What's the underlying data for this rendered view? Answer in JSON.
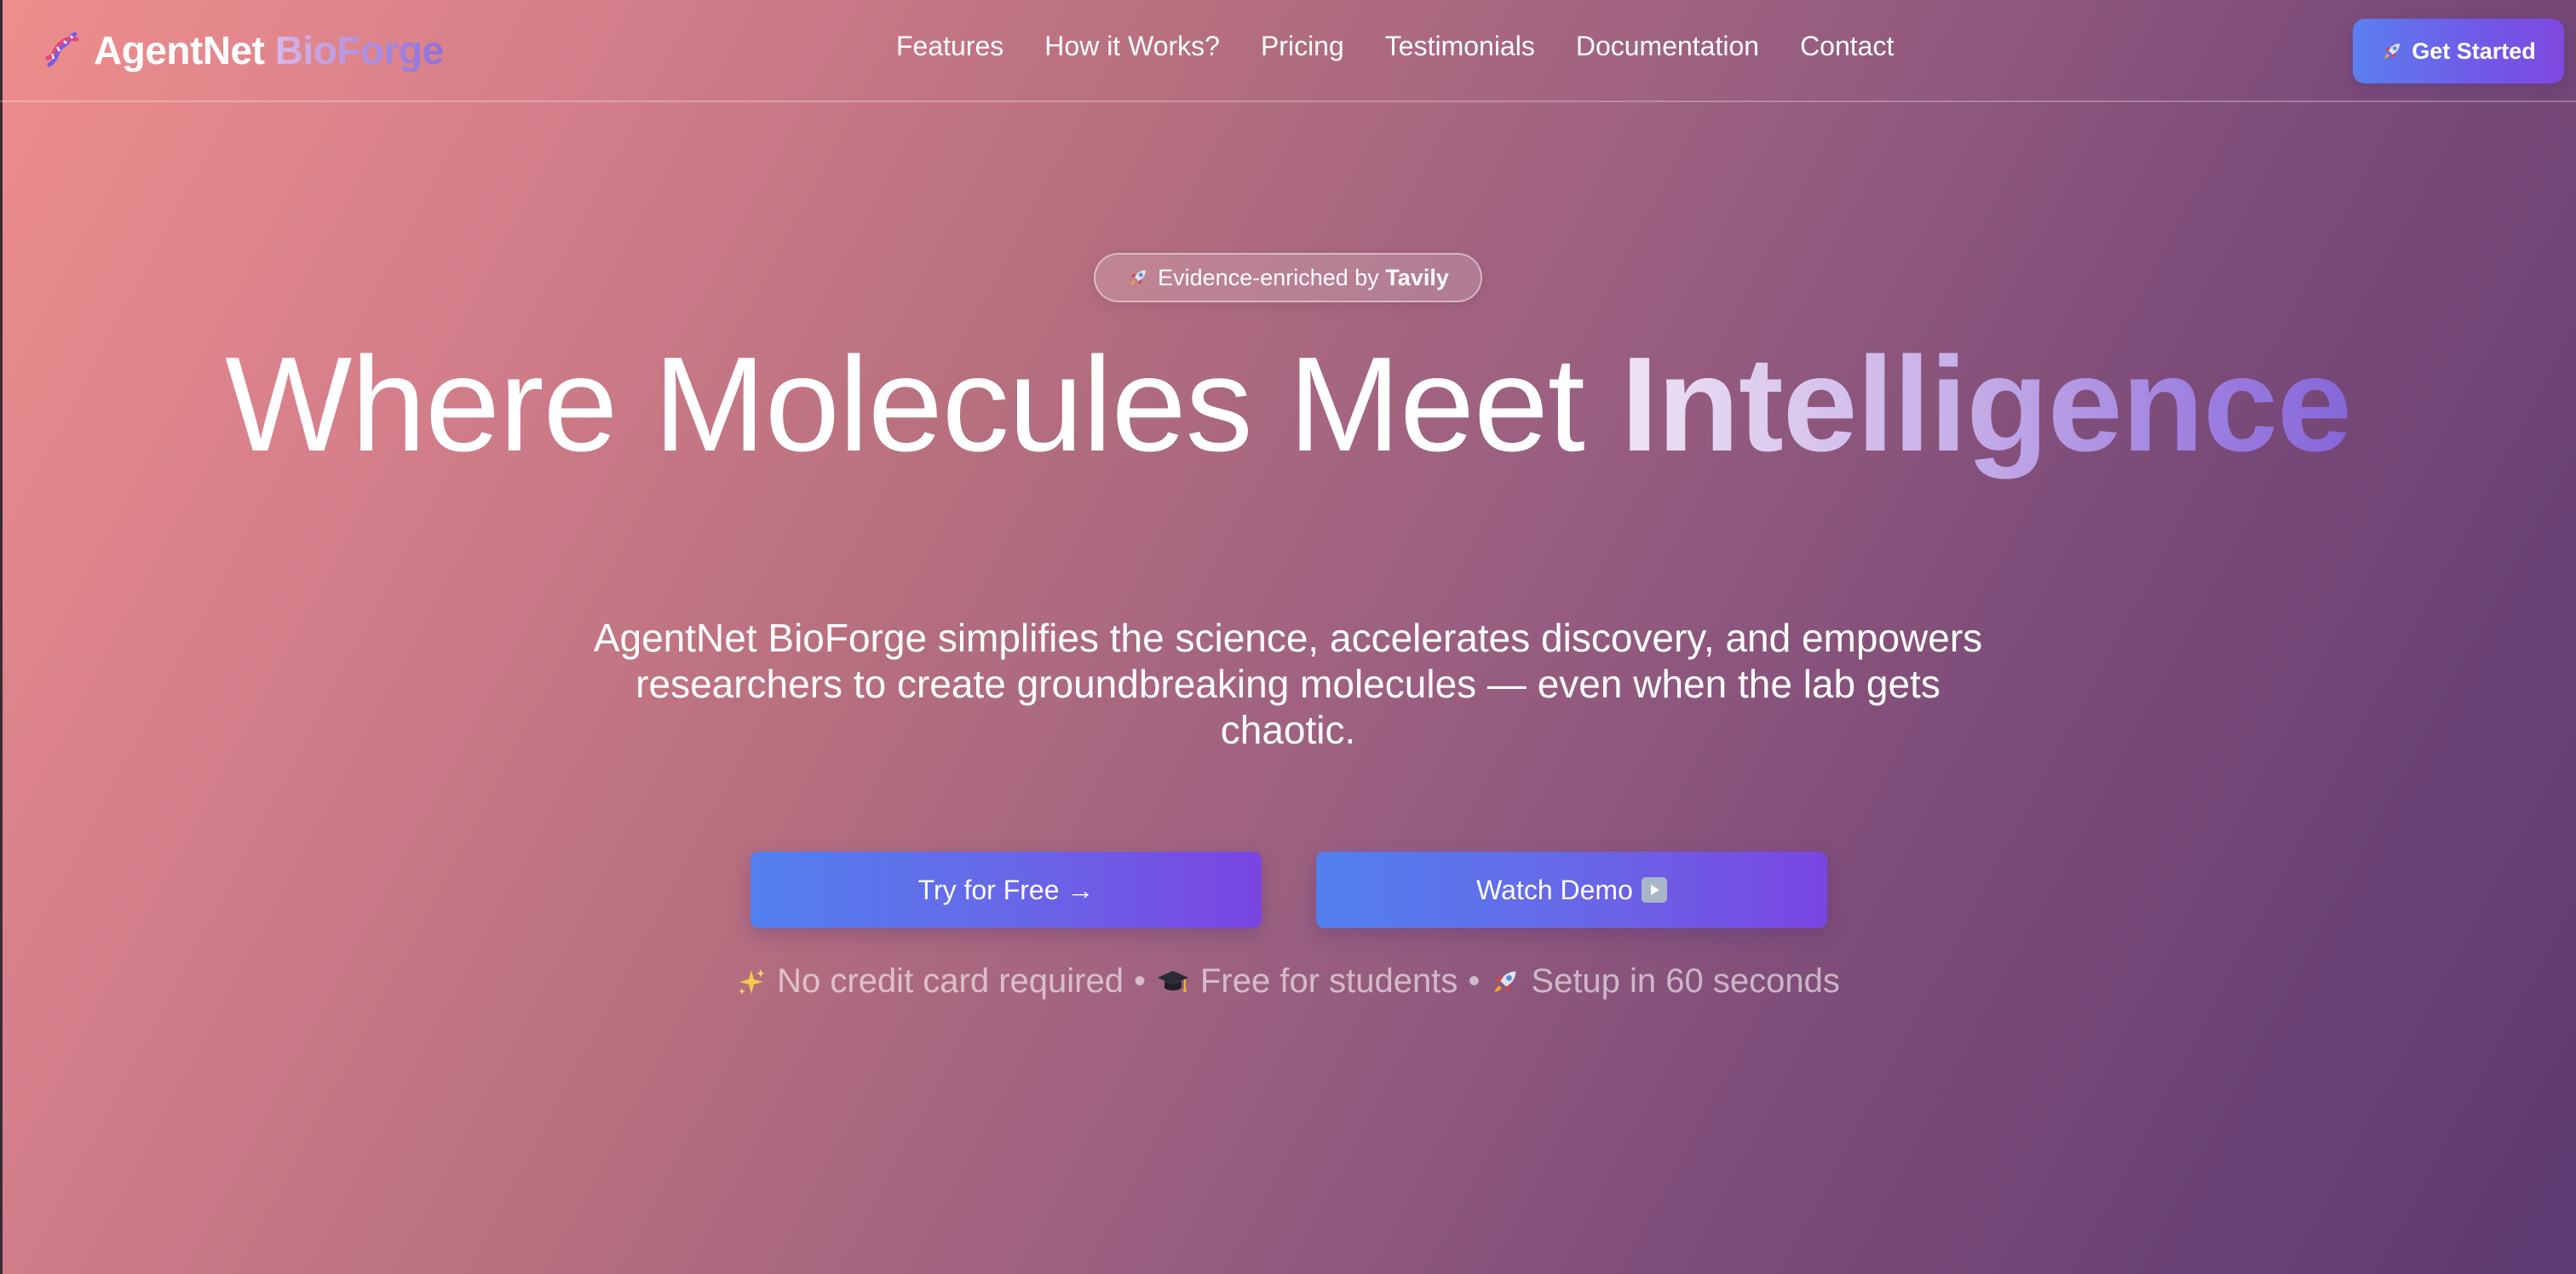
{
  "brand": {
    "name": "AgentNet",
    "accent": "BioForge",
    "icon": "dna-icon"
  },
  "nav": {
    "links": [
      "Features",
      "How it Works?",
      "Pricing",
      "Testimonials",
      "Documentation",
      "Contact"
    ],
    "cta": "Get Started",
    "cta_icon": "rocket-icon"
  },
  "hero": {
    "badge": {
      "icon": "rocket-icon",
      "text": "Evidence-enriched by",
      "strong": "Tavily"
    },
    "headline": "Where Molecules Meet",
    "headline_accent": "Intelligence",
    "subtext": "AgentNet BioForge simplifies the science, accelerates discovery, and empowers researchers to create groundbreaking molecules — even when the lab gets chaotic.",
    "primary_button": "Try for Free →",
    "secondary_button": "Watch Demo",
    "secondary_button_icon": "play-icon",
    "features": [
      {
        "icon": "sparkles-icon",
        "text": "No credit card required"
      },
      {
        "icon": "graduation-cap-icon",
        "text": "Free for students"
      },
      {
        "icon": "rocket-icon",
        "text": "Setup in 60 seconds"
      }
    ],
    "separator": "•"
  },
  "colors": {
    "gradient_start": "#ee8e8c",
    "gradient_end": "#5c3a72",
    "button_start": "#5280ee",
    "button_end": "#7a45e2",
    "accent_purple": "#8566d8"
  }
}
